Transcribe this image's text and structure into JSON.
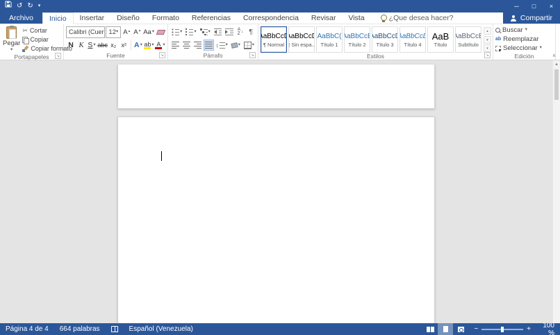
{
  "colors": {
    "accent": "#2b579a",
    "doc_background": "#e4e4e4"
  },
  "icons": {
    "undo": "↺",
    "redo": "↻",
    "caret_down": "▾",
    "tri_up": "▴",
    "tri_down": "▾",
    "minimize": "─",
    "maximize": "□",
    "close": "×",
    "scissors": "✂",
    "launcher": "↘",
    "updown": "↕",
    "collapse_ribbon": "∧",
    "scroll_up": "▲",
    "scroll_more": "▾",
    "minus": "−",
    "plus": "+"
  },
  "tabs": [
    {
      "label": "Archivo"
    },
    {
      "label": "Inicio"
    },
    {
      "label": "Insertar"
    },
    {
      "label": "Diseño"
    },
    {
      "label": "Formato"
    },
    {
      "label": "Referencias"
    },
    {
      "label": "Correspondencia"
    },
    {
      "label": "Revisar"
    },
    {
      "label": "Vista"
    }
  ],
  "tell_me": "¿Que desea hacer?",
  "share_label": "Compartir",
  "ribbon": {
    "clipboard": {
      "group_label": "Portapapeles",
      "paste": "Pegar",
      "cut": "Cortar",
      "copy": "Copiar",
      "format_painter": "Copiar formato"
    },
    "font": {
      "group_label": "Fuente",
      "font_name": "Calibri (Cuerp",
      "font_size": "12",
      "grow_font": "A",
      "shrink_font": "A",
      "change_case": "Aa",
      "bold": "N",
      "italic": "K",
      "underline": "S",
      "strikethrough": "abc",
      "subscript": "x₂",
      "superscript": "x²",
      "text_effects": "A",
      "highlight": "ab",
      "font_color": "A"
    },
    "paragraph": {
      "group_label": "Párrafo",
      "sort_a": "A",
      "sort_z": "Z",
      "sort_arrow": "↓",
      "pilcrow": "¶"
    },
    "styles": {
      "group_label": "Estilos",
      "items": [
        {
          "preview": "AaBbCcD",
          "name": "¶ Normal"
        },
        {
          "preview": "AaBbCcD",
          "name": "¶ Sin espa..."
        },
        {
          "preview": "AaBbC(",
          "name": "Título 1"
        },
        {
          "preview": "AaBbCcE",
          "name": "Título 2"
        },
        {
          "preview": "AaBbCcD",
          "name": "Título 3"
        },
        {
          "preview": "AaBbCcD",
          "name": "Título 4"
        },
        {
          "preview": "AaB",
          "name": "Título"
        },
        {
          "preview": "AaBbCcE",
          "name": "Subtítulo"
        }
      ],
      "preview_colors": [
        "#000000",
        "#000000",
        "#2e74b5",
        "#2e74b5",
        "#1f4d78",
        "#2e74b5",
        "#000000",
        "#5a6378"
      ]
    },
    "editing": {
      "group_label": "Edición",
      "find": "Buscar",
      "replace": "Reemplazar",
      "select": "Seleccionar"
    }
  },
  "statusbar": {
    "page_info": "Página 4 de 4",
    "word_count": "664 palabras",
    "language": "Español (Venezuela)",
    "zoom_level": "100 %"
  }
}
